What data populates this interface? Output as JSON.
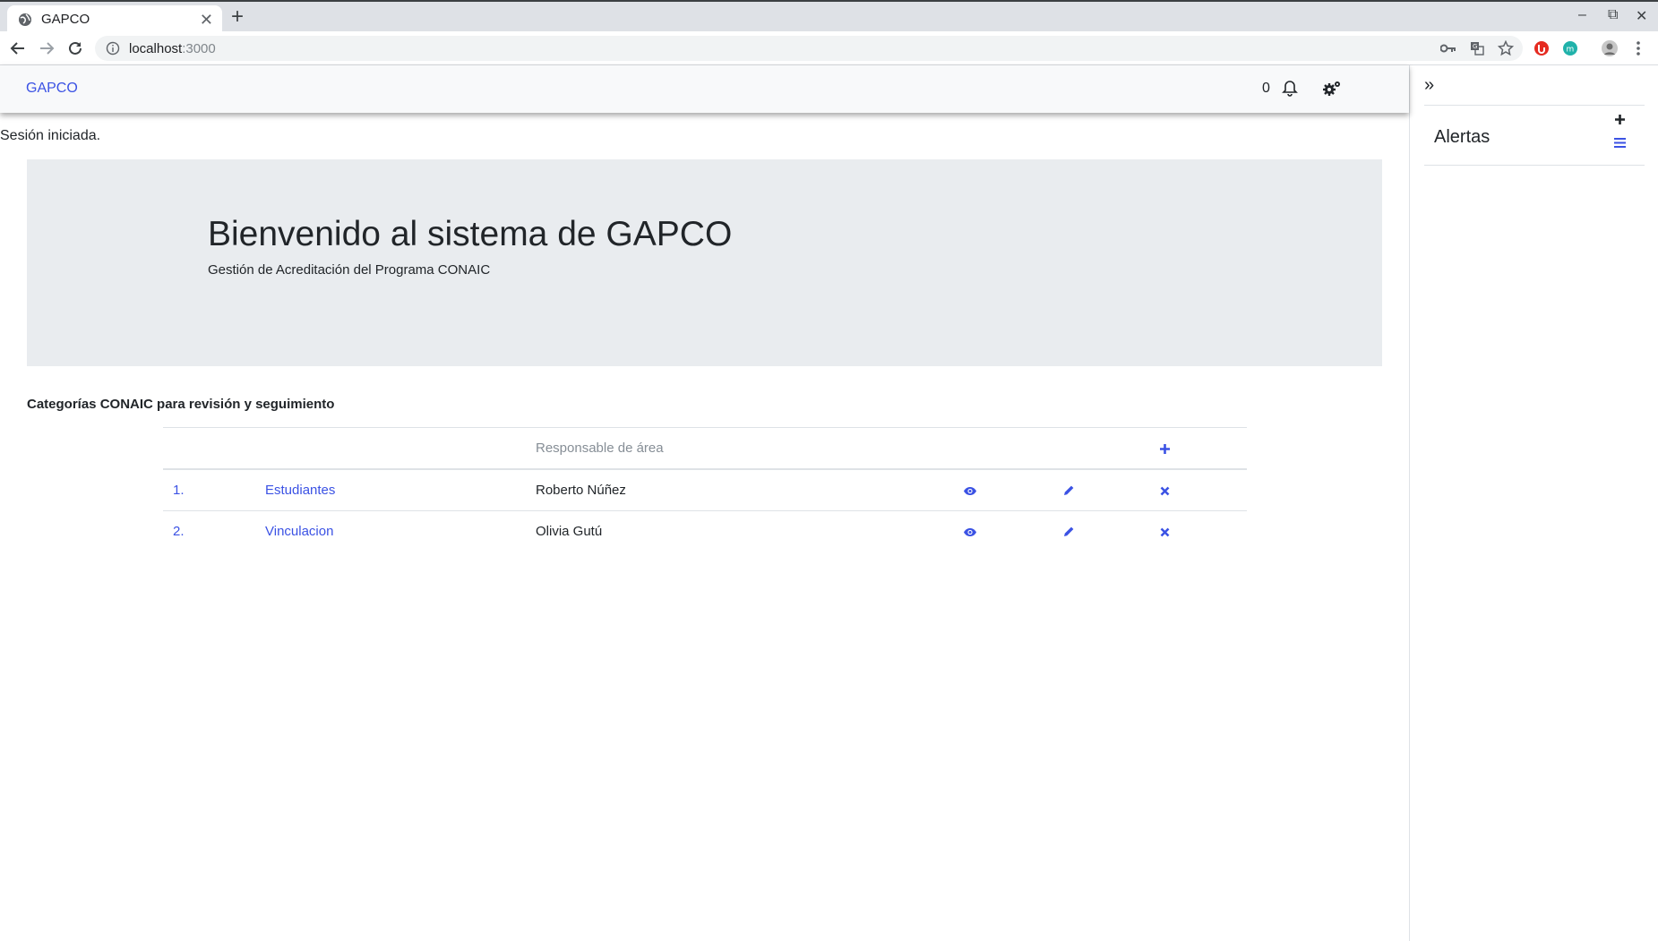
{
  "browser": {
    "tab_title": "GAPCO",
    "url_host": "localhost",
    "url_port": ":3000"
  },
  "app": {
    "brand": "GAPCO",
    "notification_count": "0",
    "session_message": "Sesión iniciada."
  },
  "jumbotron": {
    "title": "Bienvenido al sistema de GAPCO",
    "subtitle": "Gestión de Acreditación del Programa CONAIC"
  },
  "section": {
    "title": "Categorías CONAIC para revisión y seguimiento"
  },
  "table": {
    "header_responsable": "Responsable de área",
    "rows": [
      {
        "index": "1.",
        "category": "Estudiantes",
        "responsible": "Roberto Núñez"
      },
      {
        "index": "2.",
        "category": "Vinculacion",
        "responsible": "Olivia Gutú"
      }
    ]
  },
  "sidebar": {
    "title": "Alertas"
  },
  "colors": {
    "accent": "#3b52e4",
    "navbar_bg": "#f8f9fa",
    "jumbotron_bg": "#e9ecef"
  }
}
